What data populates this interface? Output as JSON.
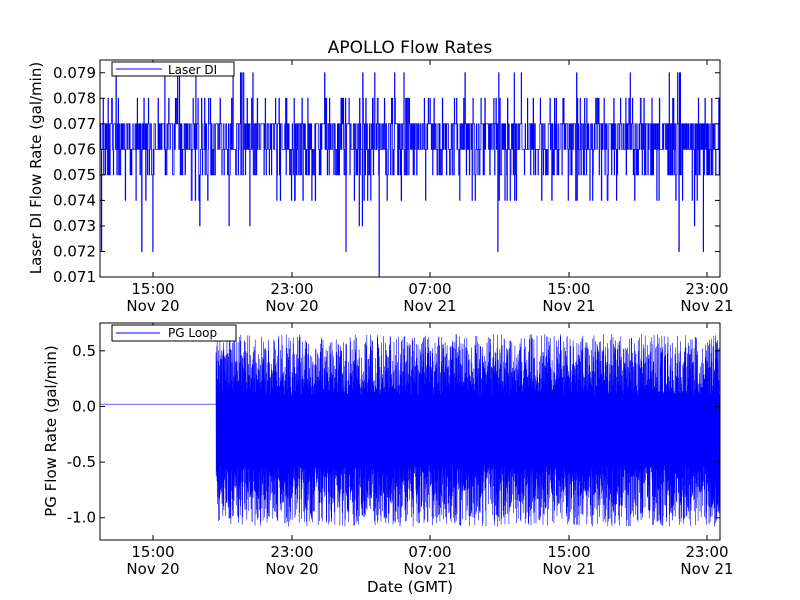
{
  "chart_data": [
    {
      "type": "line",
      "title": "APOLLO Flow Rates",
      "xlabel": "",
      "ylabel": "Laser DI Flow Rate (gal/min)",
      "ylim": [
        0.071,
        0.0795
      ],
      "yticks": [
        "0.071",
        "0.072",
        "0.073",
        "0.074",
        "0.075",
        "0.076",
        "0.077",
        "0.078",
        "0.079"
      ],
      "xlim_hours_from_nov20_00": [
        11.8,
        24.5
      ],
      "xticks": [
        {
          "time": "15:00",
          "date": "Nov 20"
        },
        {
          "time": "23:00",
          "date": "Nov 20"
        },
        {
          "time": "07:00",
          "date": "Nov 21"
        },
        {
          "time": "15:00",
          "date": "Nov 21"
        },
        {
          "time": "23:00",
          "date": "Nov 21"
        }
      ],
      "legend": {
        "position": "top-left"
      },
      "series": [
        {
          "name": "Laser DI",
          "color": "#0000ff",
          "baseline": 0.0765,
          "band": [
            0.075,
            0.077
          ],
          "min": 0.071,
          "max": 0.079
        }
      ]
    },
    {
      "type": "line",
      "title": "",
      "xlabel": "Date (GMT)",
      "ylabel": "PG Flow Rate (gal/min)",
      "ylim": [
        -1.2,
        0.75
      ],
      "yticks": [
        "-1.0",
        "-0.5",
        "0.0",
        "0.5"
      ],
      "xticks": [
        {
          "time": "15:00",
          "date": "Nov 20"
        },
        {
          "time": "23:00",
          "date": "Nov 20"
        },
        {
          "time": "07:00",
          "date": "Nov 21"
        },
        {
          "time": "15:00",
          "date": "Nov 21"
        },
        {
          "time": "23:00",
          "date": "Nov 21"
        }
      ],
      "legend": {
        "position": "top-left"
      },
      "series": [
        {
          "name": "PG Loop",
          "color": "#0000ff",
          "flat_value_until_onset": 0.02,
          "oscillation_range": [
            -1.08,
            0.65
          ]
        }
      ]
    }
  ]
}
